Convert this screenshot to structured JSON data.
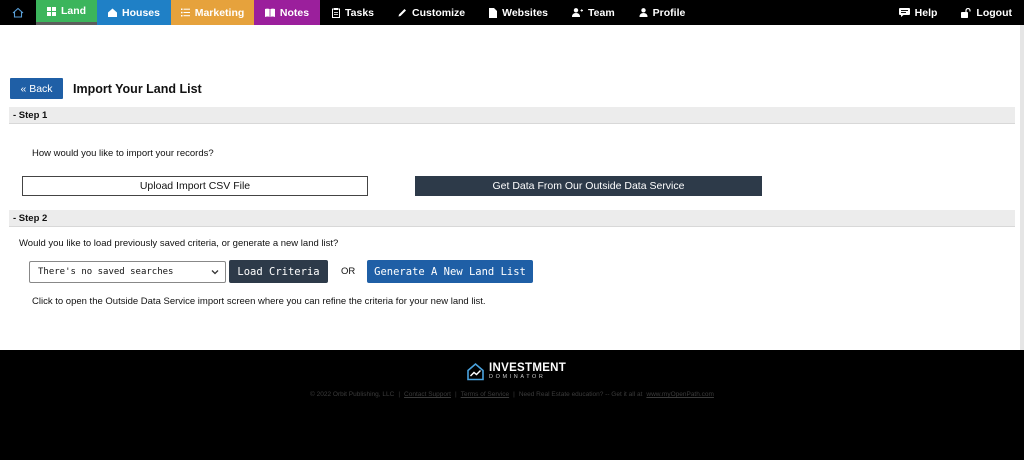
{
  "nav": {
    "home_icon": "house-outline-icon",
    "items": [
      {
        "label": "Land",
        "icon": "grid-icon",
        "bg": "#3cb55c"
      },
      {
        "label": "Houses",
        "icon": "house-icon",
        "bg": "#1f80c6"
      },
      {
        "label": "Marketing",
        "icon": "list-icon",
        "bg": "#e6a23c"
      },
      {
        "label": "Notes",
        "icon": "book-icon",
        "bg": "#9b1f9c"
      },
      {
        "label": "Tasks",
        "icon": "clipboard-icon"
      },
      {
        "label": "Customize",
        "icon": "pencil-icon"
      },
      {
        "label": "Websites",
        "icon": "document-icon"
      },
      {
        "label": "Team",
        "icon": "user-plus-icon"
      },
      {
        "label": "Profile",
        "icon": "user-icon"
      }
    ],
    "right": [
      {
        "label": "Help",
        "icon": "help-icon"
      },
      {
        "label": "Logout",
        "icon": "unlock-icon"
      }
    ]
  },
  "header": {
    "back_label": "« Back",
    "title": "Import Your Land List"
  },
  "step1": {
    "label": "- Step 1",
    "question": "How would you like to import your records?",
    "upload_label": "Upload Import CSV File",
    "outside_label": "Get Data From Our Outside Data Service"
  },
  "step2": {
    "label": "- Step 2",
    "question": "Would you like to load previously saved criteria, or generate a new land list?",
    "select_value": "There's no saved searches",
    "load_label": "Load Criteria",
    "or_label": "OR",
    "generate_label": "Generate A New Land List",
    "hint": "Click to open the Outside Data Service import screen where you can refine the criteria for your new land list."
  },
  "footer": {
    "logo_main": "INVESTMENT",
    "logo_sub": "DOMINATOR",
    "copyright": "© 2022 Orbit Publishing, LLC",
    "sep": "|",
    "contact": "Contact Support",
    "terms": "Terms of Service",
    "education": "Need Real Estate education? -- Get it all at",
    "link": "www.myOpenPath.com"
  },
  "colors": {
    "nav_bg": "#000000",
    "primary_blue": "#1f5fa6",
    "dark_button": "#2d3a49",
    "land": "#3cb55c",
    "houses": "#1f80c6",
    "marketing": "#e6a23c",
    "notes": "#9b1f9c"
  }
}
